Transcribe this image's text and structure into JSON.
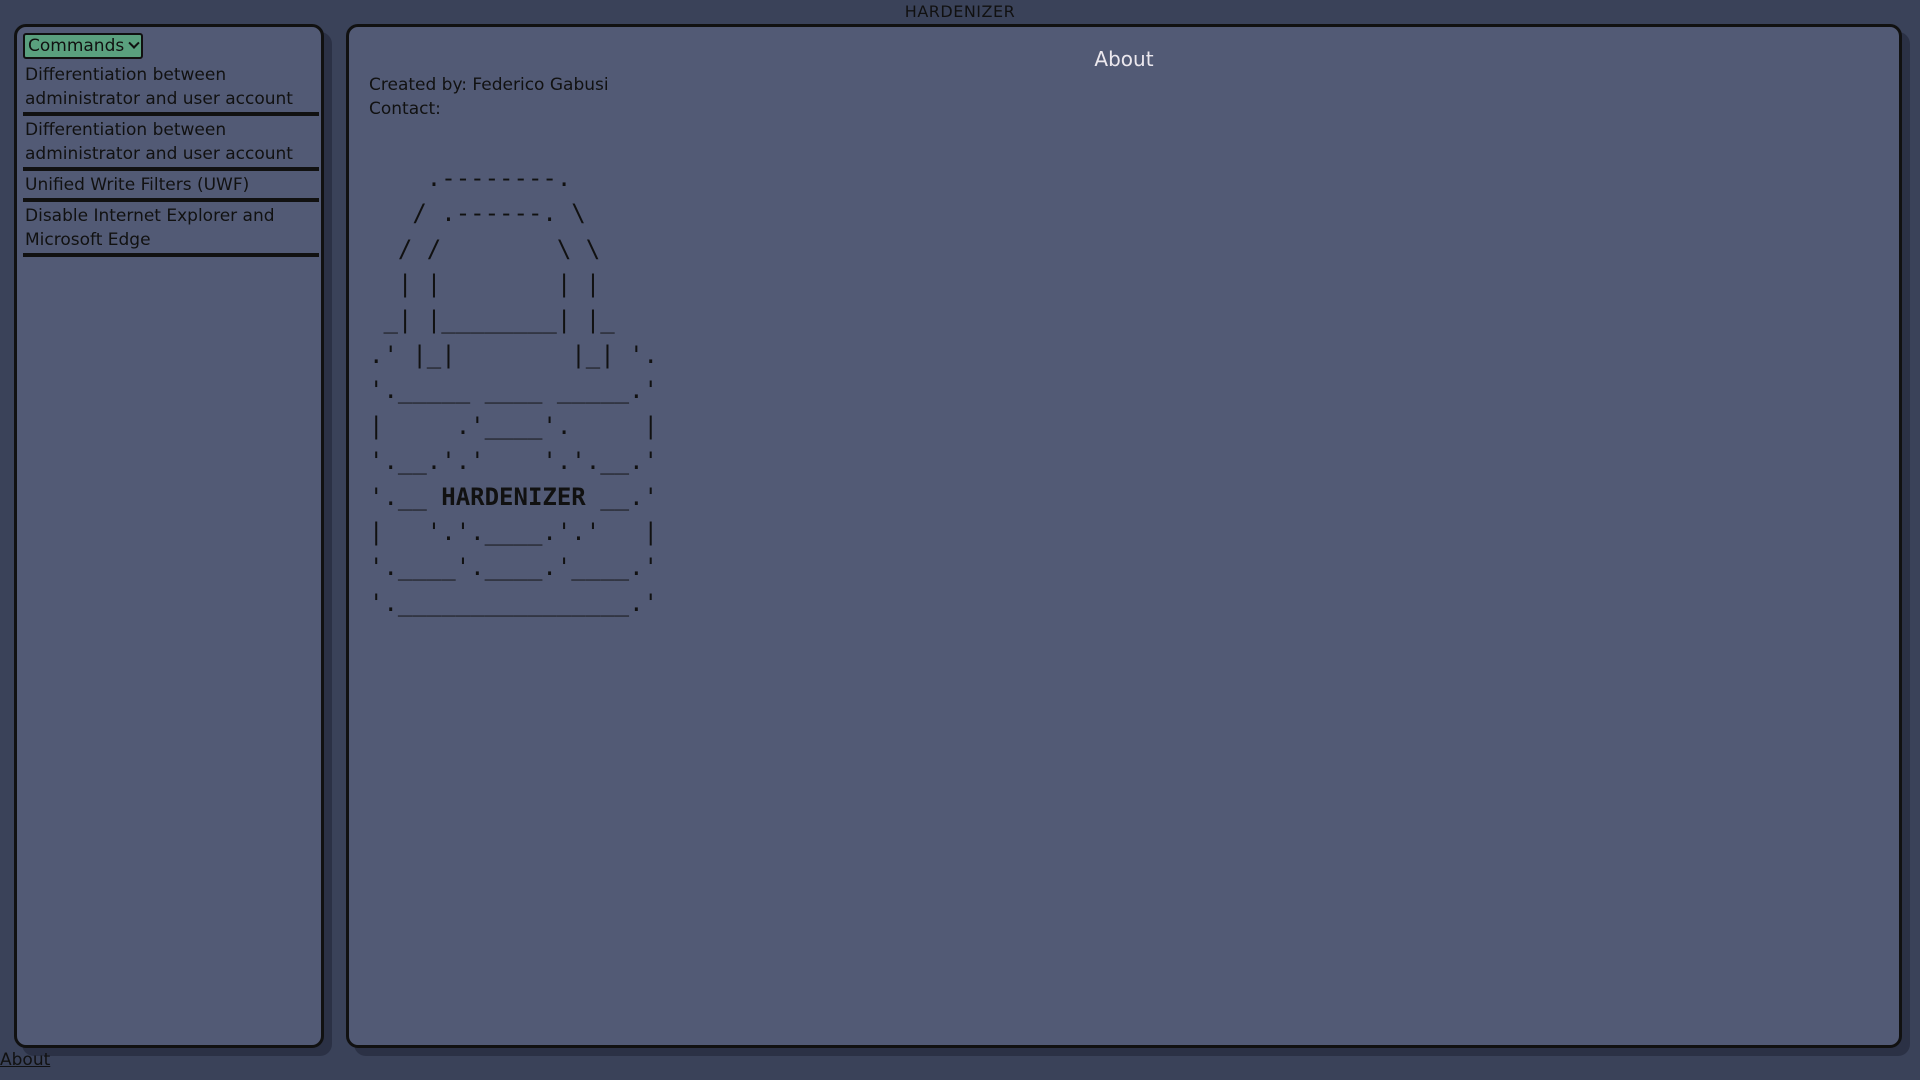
{
  "app": {
    "title": "HARDENIZER"
  },
  "sidebar": {
    "dropdown": {
      "label": "Commands"
    },
    "items": [
      {
        "label": "Differentiation between administrator and user account"
      },
      {
        "label": "Differentiation between administrator and user account"
      },
      {
        "label": "Unified Write Filters (UWF)"
      },
      {
        "label": "Disable Internet Explorer and Microsoft Edge"
      }
    ]
  },
  "main": {
    "heading": "About",
    "created_by": "Created by: Federico Gabusi",
    "contact": "Contact:",
    "ascii_logo_text": "HARDENIZER"
  },
  "footer": {
    "about_link": "About"
  },
  "colors": {
    "background": "#3a4259",
    "panel": "#525a75",
    "accent": "#5aa07e",
    "heading": "#ece8ee"
  }
}
